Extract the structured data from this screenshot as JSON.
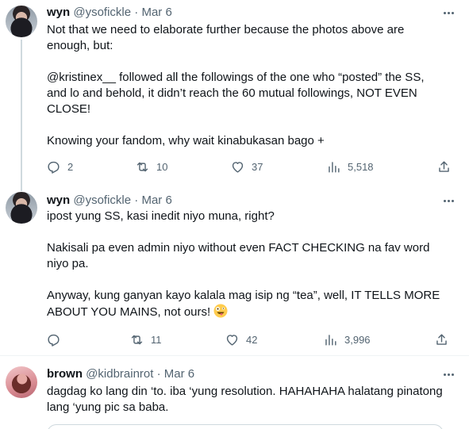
{
  "tweets": [
    {
      "name": "wyn",
      "handle": "@ysofickle",
      "dot": "·",
      "date": "Mar 6",
      "lines": [
        "Not that we need to elaborate further because the photos above are",
        "enough, but:",
        "",
        "@kristinex__ followed all the followings of the one who “posted” the SS,",
        "and lo and behold, it didn’t reach the 60 mutual followings, NOT EVEN",
        "CLOSE!",
        "",
        "Knowing your fandom, why wait kinabukasan bago +"
      ],
      "replies": "2",
      "retweets": "10",
      "likes": "37",
      "views": "5,518"
    },
    {
      "name": "wyn",
      "handle": "@ysofickle",
      "dot": "·",
      "date": "Mar 6",
      "lines": [
        "ipost yung SS, kasi inedit niyo muna, right?",
        "",
        "Nakisali pa even admin niyo without even FACT CHECKING na fav word",
        "niyo pa.",
        "",
        "Anyway, kung ganyan kayo kalala mag isip ng “tea”, well, IT TELLS MORE"
      ],
      "last_line": "ABOUT YOU MAINS, not ours!",
      "emoji": "zany-face-emoji",
      "replies": "",
      "retweets": "11",
      "likes": "42",
      "views": "3,996"
    },
    {
      "name": "brown",
      "handle": "@kidbrainrot",
      "dot": "·",
      "date": "Mar 6",
      "lines": [
        "dagdag ko lang din ‘to. iba ‘yung resolution. HAHAHAHA halatang pinatong",
        "lang ‘yung pic sa baba."
      ]
    }
  ],
  "icons": {
    "reply": "reply-icon",
    "retweet": "retweet-icon",
    "like": "heart-icon",
    "views": "views-icon",
    "share": "share-icon",
    "more": "more-options-icon"
  }
}
